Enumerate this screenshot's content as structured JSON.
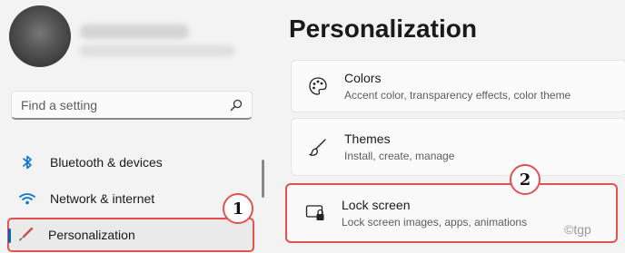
{
  "sidebar": {
    "search": {
      "placeholder": "Find a setting"
    },
    "items": [
      {
        "label": "Bluetooth & devices",
        "icon": "bluetooth-icon"
      },
      {
        "label": "Network & internet",
        "icon": "wifi-icon"
      },
      {
        "label": "Personalization",
        "icon": "paintbrush-icon",
        "selected": true
      }
    ]
  },
  "main": {
    "title": "Personalization",
    "cards": [
      {
        "title": "Colors",
        "subtitle": "Accent color, transparency effects, color theme",
        "icon": "palette-icon"
      },
      {
        "title": "Themes",
        "subtitle": "Install, create, manage",
        "icon": "brush-icon"
      },
      {
        "title": "Lock screen",
        "subtitle": "Lock screen images, apps, animations",
        "icon": "lock-screen-icon"
      }
    ]
  },
  "annotations": {
    "step1": "1",
    "step2": "2",
    "watermark": "©tgp"
  },
  "colors": {
    "accent": "#0067c0",
    "highlight": "#e55050"
  }
}
